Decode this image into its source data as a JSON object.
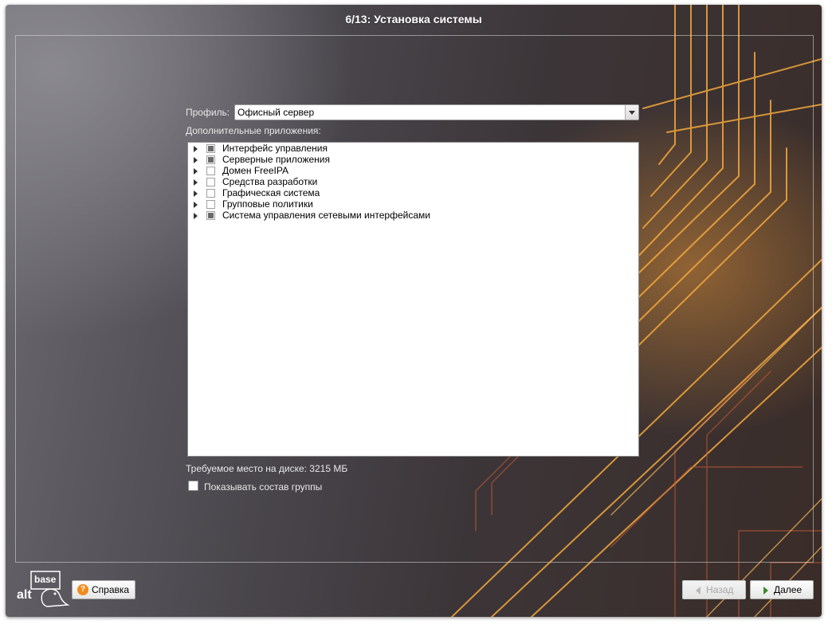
{
  "window": {
    "title": "6/13: Установка системы"
  },
  "profile": {
    "label": "Профиль:",
    "value": "Офисный сервер"
  },
  "apps": {
    "label": "Дополнительные приложения:",
    "items": [
      {
        "label": "Интерфейс управления",
        "state": "partial"
      },
      {
        "label": "Серверные приложения",
        "state": "partial"
      },
      {
        "label": "Домен FreeIPA",
        "state": "unchecked"
      },
      {
        "label": "Средства разработки",
        "state": "unchecked"
      },
      {
        "label": "Графическая система",
        "state": "unchecked"
      },
      {
        "label": "Групповые политики",
        "state": "unchecked"
      },
      {
        "label": "Система управления сетевыми интерфейсами",
        "state": "partial"
      }
    ]
  },
  "disk": {
    "label": "Требуемое место на диске: 3215 МБ"
  },
  "show_group": {
    "label": "Показывать состав группы",
    "checked": false
  },
  "logo": {
    "line1": "base",
    "line2": "alt"
  },
  "buttons": {
    "help": "Справка",
    "back": "Назад",
    "next": "Далее"
  },
  "colors": {
    "accent": "#f0a030",
    "help_icon": "#f08c1e",
    "next_arrow": "#3c8a2e"
  }
}
